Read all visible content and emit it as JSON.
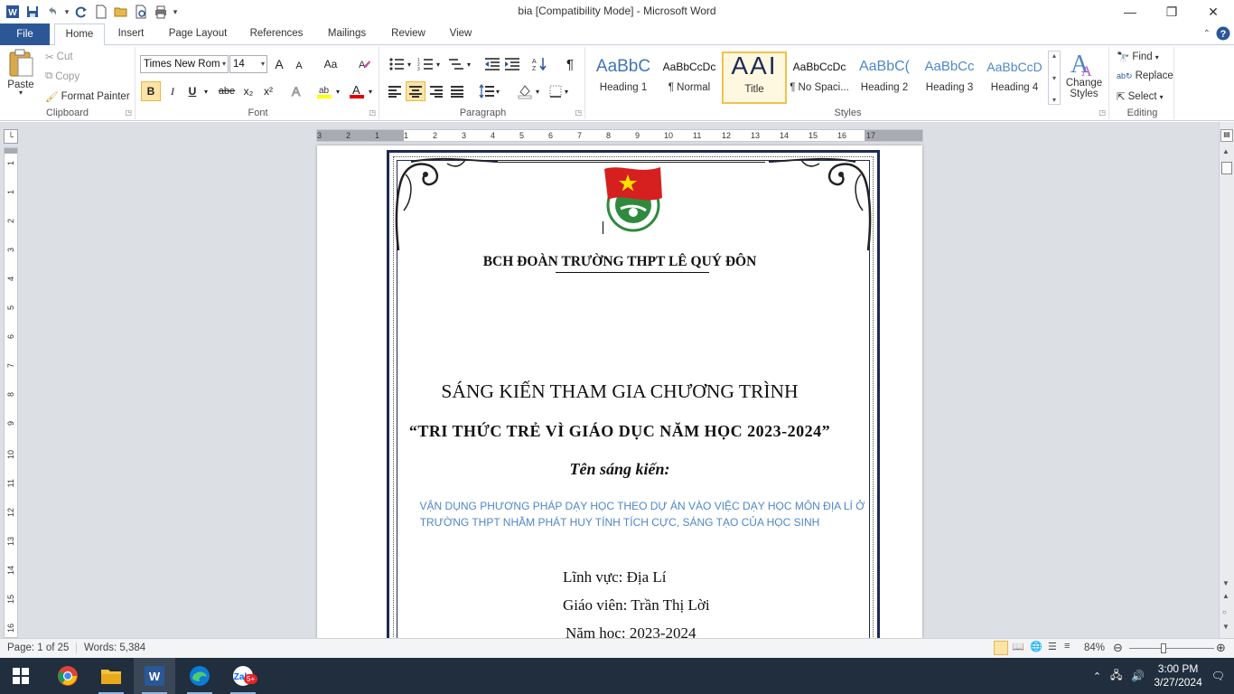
{
  "window": {
    "title": "bia [Compatibility Mode]  -  Microsoft Word",
    "minimize": "—",
    "restore": "❐",
    "close": "✕"
  },
  "tabs": [
    "File",
    "Home",
    "Insert",
    "Page Layout",
    "References",
    "Mailings",
    "Review",
    "View"
  ],
  "clipboard": {
    "paste": "Paste",
    "cut": "Cut",
    "copy": "Copy",
    "format_painter": "Format Painter",
    "label": "Clipboard"
  },
  "font": {
    "family": "Times New Rom",
    "size": "14",
    "label": "Font",
    "bold": "B",
    "italic": "I",
    "underline": "U",
    "strike": "abe",
    "subscript": "x₂",
    "superscript": "x²",
    "grow": "A",
    "shrink": "A",
    "case": "Aa",
    "highlight_color": "#ffff00",
    "font_color": "#e00000"
  },
  "paragraph": {
    "label": "Paragraph"
  },
  "styles": {
    "label": "Styles",
    "items": [
      {
        "preview": "AaBbC",
        "name": "Heading 1"
      },
      {
        "preview": "AaBbCcDc",
        "name": "¶ Normal"
      },
      {
        "preview": "AAI",
        "name": "Title"
      },
      {
        "preview": "AaBbCcDc",
        "name": "¶ No Spaci..."
      },
      {
        "preview": "AaBbC(",
        "name": "Heading 2"
      },
      {
        "preview": "AaBbCc",
        "name": "Heading 3"
      },
      {
        "preview": "AaBbCcD",
        "name": "Heading 4"
      }
    ],
    "change_styles": "Change Styles"
  },
  "editing": {
    "label": "Editing",
    "find": "Find",
    "replace": "Replace",
    "select": "Select"
  },
  "ruler": {
    "h_ticks": [
      "3",
      "2",
      "1",
      "1",
      "2",
      "3",
      "4",
      "5",
      "6",
      "7",
      "8",
      "9",
      "10",
      "11",
      "12",
      "13",
      "14",
      "15",
      "16",
      "17"
    ],
    "v_ticks": [
      "1",
      "1",
      "2",
      "3",
      "4",
      "5",
      "6",
      "7",
      "8",
      "9",
      "10",
      "11",
      "12",
      "13",
      "14",
      "15",
      "16"
    ]
  },
  "document": {
    "org": "BCH ĐOÀN TRƯỜNG THPT LÊ QUÝ ĐÔN",
    "heading1": "SÁNG KIẾN THAM GIA CHƯƠNG TRÌNH",
    "heading2": "“TRI THỨC TRẺ VÌ GIÁO DỤC NĂM HỌC 2023-2024”",
    "subheading": "Tên sáng kiến:",
    "topic_line1": "VẬN DỤNG PHƯƠNG PHÁP DẠY HỌC THEO DỰ ÁN VÀO VIỆC DẠY HỌC MÔN ĐỊA LÍ Ở",
    "topic_line2": "TRƯỜNG THPT NHẰM PHÁT HUY TÍNH TÍCH CỰC, SÁNG TẠO CỦA HỌC SINH",
    "field": "Lĩnh vực: Địa Lí",
    "teacher": "Giáo viên: Trần Thị Lời",
    "year": "Năm học: 2023-2024",
    "topic_color": "#4f87c7"
  },
  "status": {
    "page": "Page: 1 of 25",
    "words": "Words: 5,384",
    "zoom": "84%"
  },
  "taskbar": {
    "zalo_badge": "5+",
    "time": "3:00 PM",
    "date": "3/27/2024"
  }
}
